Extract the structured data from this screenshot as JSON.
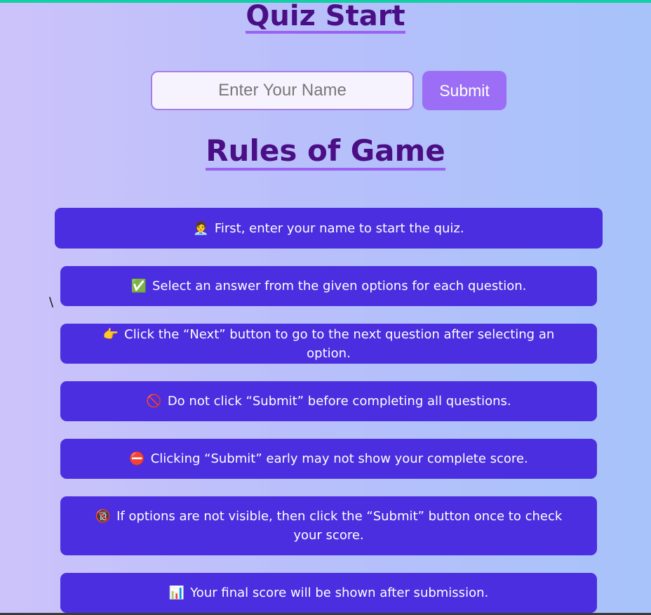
{
  "quiz": {
    "title": "Quiz Start",
    "name_placeholder": "Enter Your Name",
    "submit_label": "Submit"
  },
  "rules": {
    "title": "Rules of Game",
    "items": [
      {
        "icon": "🧑‍💼",
        "text": "First, enter your name to start the quiz."
      },
      {
        "icon": "✅",
        "text": "Select an answer from the given options for each question."
      },
      {
        "icon": "👉",
        "text": "Click the “Next” button to go to the next question after selecting an option."
      },
      {
        "icon": "🚫",
        "text": "Do not click “Submit” before completing all questions."
      },
      {
        "icon": "⛔",
        "text": "Clicking “Submit” early may not show your complete score."
      },
      {
        "icon": "🔞",
        "text": "If options are not visible, then click the “Submit” button once to check your score."
      },
      {
        "icon": "📊",
        "text": "Your final score will be shown after submission."
      }
    ]
  },
  "stray_char": "\\",
  "colors": {
    "heading": "#4b0f85",
    "underline": "#9a62f2",
    "rule_bg": "#4a2ee0",
    "submit_bg": "#9b6ef5",
    "top_strip": "#12cfa6"
  }
}
